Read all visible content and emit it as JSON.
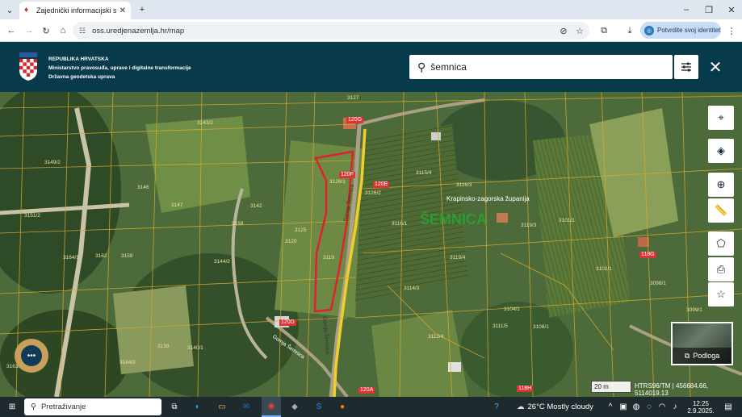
{
  "browser": {
    "tab_title": "Zajednički informacijski sustav",
    "url": "oss.uredjenazemlja.hr/map",
    "identity_button": "Potvrdite svoj identitet"
  },
  "header": {
    "line1": "REPUBLIKA HRVATSKA",
    "line2": "Ministarstvo pravosuđa, uprave i digitalne transformacije",
    "line3": "Državna geodetska uprava",
    "search_value": "šemnica"
  },
  "map": {
    "place_name": "ŠEMNICA",
    "region_label": "Krapinsko-zagorska županija",
    "street_labels": [
      "Gornja Šemnica",
      "Gornja Šemnica",
      "Gornja Šemnica"
    ],
    "house_numbers": [
      "120G",
      "120F",
      "120E",
      "120D",
      "120A",
      "118G",
      "118H"
    ],
    "parcel_numbers": [
      "3126/1",
      "3126/2",
      "3125",
      "3120",
      "3119",
      "3127",
      "3115/4",
      "3116/3",
      "3116/1",
      "3114/3",
      "3119/4",
      "3143/2",
      "3151/2",
      "3149/2",
      "3147",
      "3146",
      "3164/1",
      "3162",
      "3159",
      "3158",
      "3144/2",
      "3139",
      "3140/1",
      "3142",
      "3108/1",
      "3119/3",
      "3098/1",
      "3101/1",
      "3104/1",
      "3099/1",
      "3102/1",
      "3112/4",
      "3111/5",
      "3163/3",
      "3164/2"
    ],
    "scale": "20 m",
    "coordinates": "HTRS96/TM | 456684.66, 5114019.13",
    "basemap_label": "Podloga"
  },
  "taskbar": {
    "search_placeholder": "Pretraživanje",
    "weather": "26°C  Mostly cloudy",
    "time": "12:25",
    "date": "2.9.2025."
  }
}
